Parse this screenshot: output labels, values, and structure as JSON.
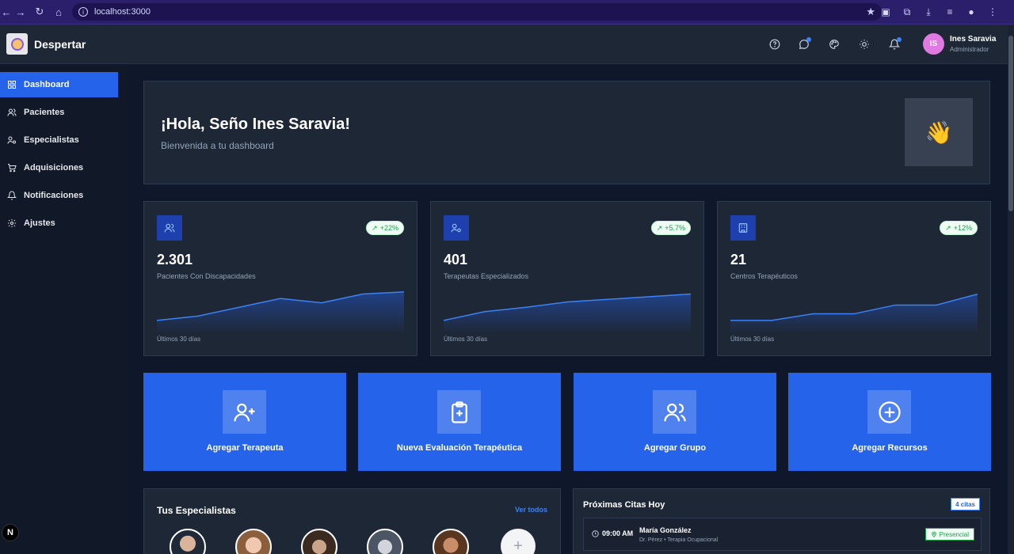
{
  "browser": {
    "url": "localhost:3000"
  },
  "app": {
    "brand": "Despertar"
  },
  "user": {
    "initials": "IS",
    "name": "Ines Saravia",
    "role": "Administrador"
  },
  "sidebar": {
    "items": [
      {
        "label": "Dashboard",
        "icon": "grid-icon"
      },
      {
        "label": "Pacientes",
        "icon": "users-icon"
      },
      {
        "label": "Especialistas",
        "icon": "user-key-icon"
      },
      {
        "label": "Adquisiciones",
        "icon": "cart-icon"
      },
      {
        "label": "Notificaciones",
        "icon": "bell-icon"
      },
      {
        "label": "Ajustes",
        "icon": "gear-icon"
      }
    ]
  },
  "welcome": {
    "title": "¡Hola, Seño Ines Saravia!",
    "subtitle": "Bienvenida a tu dashboard"
  },
  "stats": [
    {
      "value": "2.301",
      "label": "Pacientes Con Discapacidades",
      "badge": "+22%",
      "footer": "Últimos 30 días",
      "trend": [
        2,
        3,
        5,
        7,
        6,
        8,
        8.5
      ]
    },
    {
      "value": "401",
      "label": "Terapeutas Especializados",
      "badge": "+5.7%",
      "footer": "Últimos 30 días",
      "trend": [
        2,
        4,
        5,
        6.2,
        6.8,
        7.4,
        8
      ]
    },
    {
      "value": "21",
      "label": "Centros Terapéuticos",
      "badge": "+12%",
      "footer": "Últimos 30 días",
      "trend": [
        2,
        2,
        3.5,
        3.5,
        5.5,
        5.5,
        8
      ]
    }
  ],
  "actions": [
    {
      "label": "Agregar Terapeuta",
      "icon": "user-plus-icon"
    },
    {
      "label": "Nueva Evaluación Terapéutica",
      "icon": "clipboard-plus-icon"
    },
    {
      "label": "Agregar Grupo",
      "icon": "users-group-icon"
    },
    {
      "label": "Agregar Recursos",
      "icon": "plus-circle-icon"
    }
  ],
  "specialists": {
    "title": "Tus Especialistas",
    "see_all": "Ver todos",
    "add_symbol": "+"
  },
  "appointments": {
    "title": "Próximas Citas Hoy",
    "count": "4 citas",
    "items": [
      {
        "time": "09:00 AM",
        "name": "María González",
        "detail": "Dr. Pérez • Terapia Ocupacional",
        "type": "Presencial"
      }
    ]
  },
  "colors": {
    "accent": "#2563eb",
    "success": "#16a34a",
    "card": "#1e2736",
    "background": "#0f172a"
  }
}
